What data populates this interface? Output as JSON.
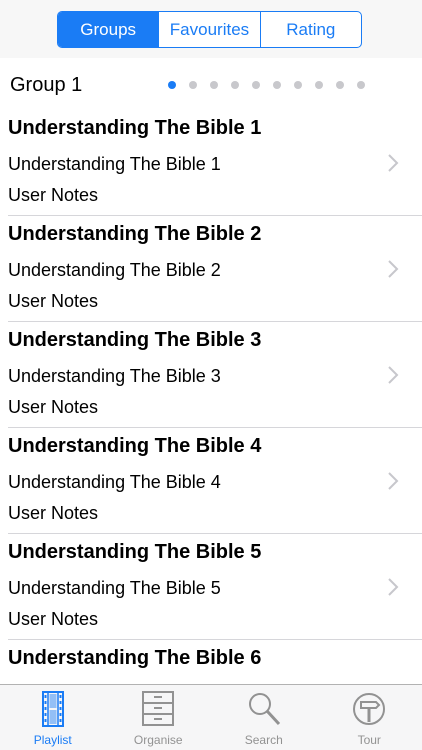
{
  "segments": [
    "Groups",
    "Favourites",
    "Rating"
  ],
  "group_title": "Group 1",
  "pager": {
    "count": 10,
    "active_index": 0
  },
  "rows": [
    {
      "title": "Understanding The Bible 1",
      "subtitle": "Understanding The Bible 1",
      "notes": "User Notes"
    },
    {
      "title": "Understanding The Bible 2",
      "subtitle": "Understanding The Bible 2",
      "notes": "User Notes"
    },
    {
      "title": "Understanding The Bible 3",
      "subtitle": "Understanding The Bible 3",
      "notes": "User Notes"
    },
    {
      "title": "Understanding The Bible 4",
      "subtitle": "Understanding The Bible 4",
      "notes": "User Notes"
    },
    {
      "title": "Understanding The Bible 5",
      "subtitle": "Understanding The Bible 5",
      "notes": "User Notes"
    },
    {
      "title": "Understanding The Bible 6",
      "subtitle": "",
      "notes": ""
    }
  ],
  "tabs": [
    {
      "label": "Playlist",
      "icon": "film-strip-icon"
    },
    {
      "label": "Organise",
      "icon": "cabinet-icon"
    },
    {
      "label": "Search",
      "icon": "magnifier-icon"
    },
    {
      "label": "Tour",
      "icon": "signpost-icon"
    }
  ],
  "colors": {
    "accent": "#1a7cf5",
    "inactive": "#929292"
  }
}
